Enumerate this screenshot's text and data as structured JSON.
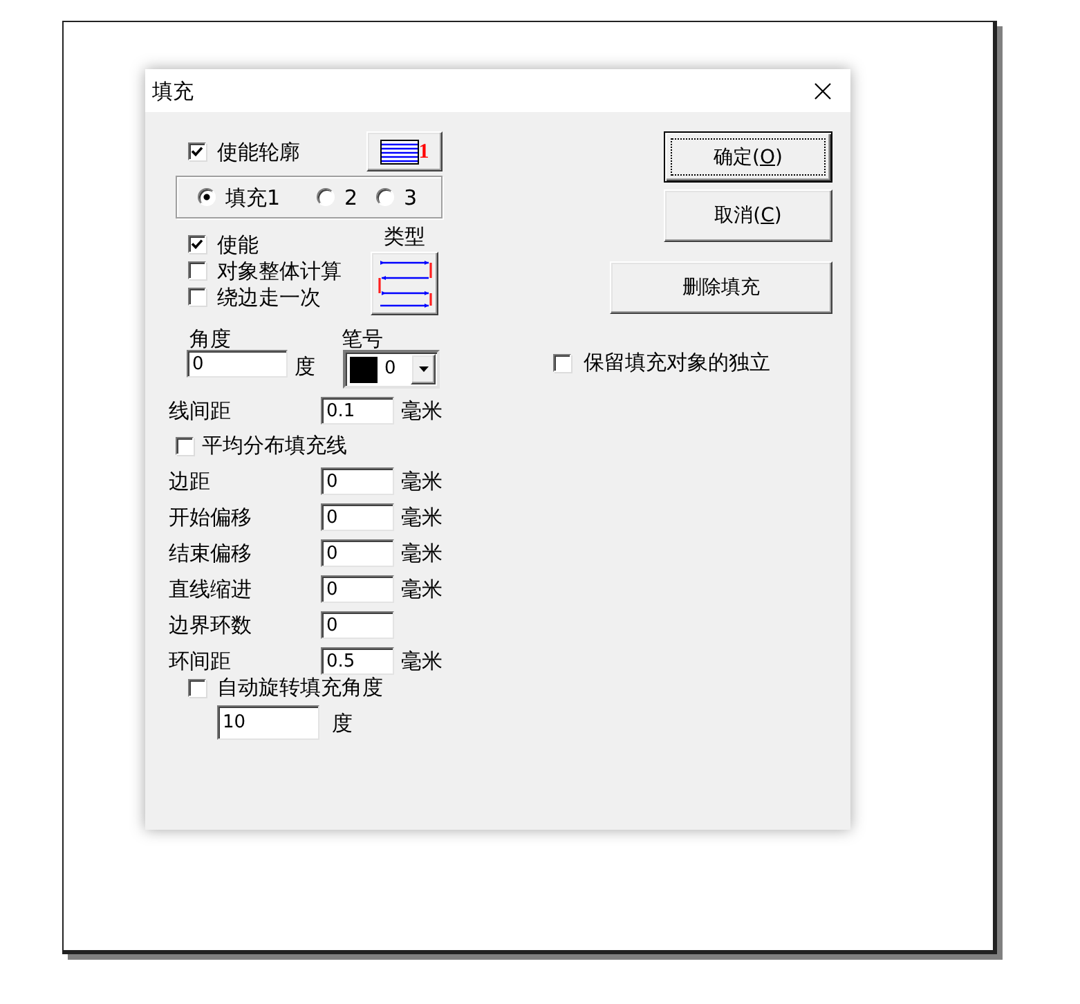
{
  "window": {
    "title": "填充"
  },
  "outline": {
    "label": "使能轮廓",
    "checked": true,
    "button_label": "1"
  },
  "fill_selector": [
    {
      "label": "填充1",
      "selected": true
    },
    {
      "label": "2",
      "selected": false
    },
    {
      "label": "3",
      "selected": false
    }
  ],
  "fill_options": [
    {
      "label": "使能",
      "checked": true
    },
    {
      "label": "对象整体计算",
      "checked": false
    },
    {
      "label": "绕边走一次",
      "checked": false
    }
  ],
  "type": {
    "label": "类型"
  },
  "angle": {
    "label": "角度",
    "value": "0",
    "unit": "度"
  },
  "pen": {
    "label": "笔号",
    "value": "0"
  },
  "rows": [
    {
      "kind": "field",
      "label": "线间距",
      "value": "0.1",
      "unit": "毫米"
    },
    {
      "kind": "checkbox",
      "label": "平均分布填充线",
      "checked": false
    },
    {
      "kind": "field",
      "label": "边距",
      "value": "0",
      "unit": "毫米"
    },
    {
      "kind": "field",
      "label": "开始偏移",
      "value": "0",
      "unit": "毫米"
    },
    {
      "kind": "field",
      "label": "结束偏移",
      "value": "0",
      "unit": "毫米"
    },
    {
      "kind": "field",
      "label": "直线缩进",
      "value": "0",
      "unit": "毫米"
    },
    {
      "kind": "field",
      "label": "边界环数",
      "value": "0"
    },
    {
      "kind": "field",
      "label": "环间距",
      "value": "0.5",
      "unit": "毫米"
    }
  ],
  "auto_rotate": {
    "label": "自动旋转填充角度",
    "checked": false,
    "value": "10",
    "unit": "度"
  },
  "buttons": [
    {
      "label": "确定(",
      "access_key": "O",
      "label_end": ")",
      "default": true
    },
    {
      "label": "取消(",
      "access_key": "C",
      "label_end": ")",
      "default": false
    }
  ],
  "delete_button": {
    "label": "删除填充"
  },
  "keep_independent": {
    "label": "保留填充对象的独立",
    "checked": false
  }
}
